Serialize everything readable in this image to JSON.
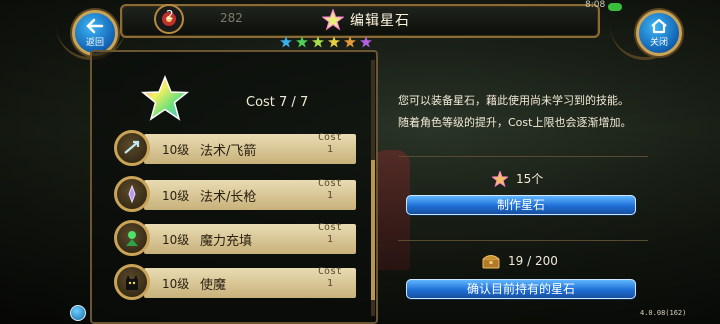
{
  "header": {
    "title": "编辑星石",
    "badge_count": "2",
    "dim_value": "282",
    "status_text": "8:08"
  },
  "buttons": {
    "back_label": "返回",
    "close_label": "关闭"
  },
  "left_panel": {
    "cost_label": "Cost 7 / 7",
    "skills": [
      {
        "level": "10级",
        "name": "法术/飞箭",
        "cost_label": "Cost",
        "cost_value": "1",
        "icon": "arrow-icon"
      },
      {
        "level": "10级",
        "name": "法术/长枪",
        "cost_label": "Cost",
        "cost_value": "1",
        "icon": "lance-icon"
      },
      {
        "level": "10级",
        "name": "魔力充填",
        "cost_label": "Cost",
        "cost_value": "1",
        "icon": "mana-charge-icon"
      },
      {
        "level": "10级",
        "name": "使魔",
        "cost_label": "Cost",
        "cost_value": "1",
        "icon": "familiar-cat-icon"
      }
    ]
  },
  "right_panel": {
    "desc_line_1": "您可以装备星石，藉此使用尚未学习到的技能。",
    "desc_line_2": "随着角色等级的提升，Cost上限也会逐渐增加。",
    "star_count": "15个",
    "make_button": "制作星石",
    "chest_count": "19 / 200",
    "confirm_button": "确认目前持有的星石"
  },
  "footer": {
    "version": "4.0.08(162)"
  },
  "colors": {
    "gold_border": "#c9a356",
    "button_blue": "#1f6fd6",
    "row_parchment": "#e9dcb3"
  }
}
